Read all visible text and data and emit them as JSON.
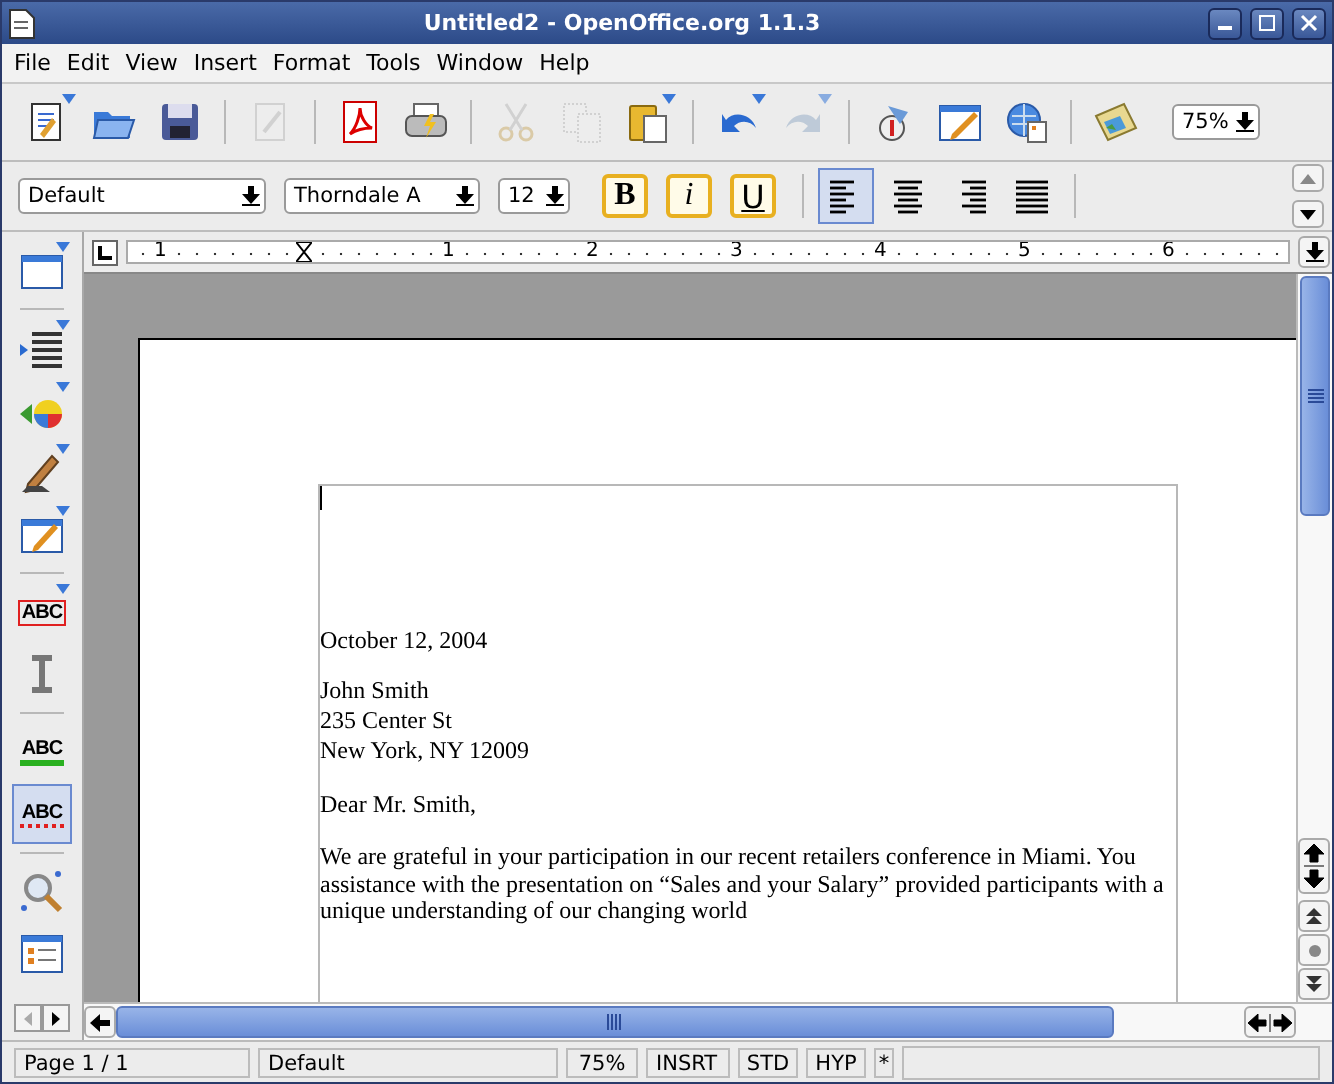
{
  "window": {
    "title": "Untitled2 - OpenOffice.org 1.1.3"
  },
  "menu": [
    {
      "label": "File"
    },
    {
      "label": "Edit"
    },
    {
      "label": "View"
    },
    {
      "label": "Insert"
    },
    {
      "label": "Format"
    },
    {
      "label": "Tools"
    },
    {
      "label": "Window"
    },
    {
      "label": "Help"
    }
  ],
  "function_bar": [
    {
      "kind": "new",
      "disabled": false,
      "menu": true
    },
    {
      "kind": "open",
      "disabled": false,
      "menu": false
    },
    {
      "kind": "save",
      "disabled": false,
      "menu": false
    },
    {
      "kind": "separator"
    },
    {
      "kind": "edit",
      "disabled": true,
      "menu": false
    },
    {
      "kind": "separator"
    },
    {
      "kind": "pdf",
      "disabled": false,
      "menu": false
    },
    {
      "kind": "print",
      "disabled": false,
      "menu": false
    },
    {
      "kind": "separator"
    },
    {
      "kind": "cut",
      "disabled": true,
      "menu": false
    },
    {
      "kind": "copy",
      "disabled": true,
      "menu": false
    },
    {
      "kind": "paste",
      "disabled": false,
      "menu": true
    },
    {
      "kind": "separator"
    },
    {
      "kind": "undo",
      "disabled": false,
      "menu": true
    },
    {
      "kind": "redo",
      "disabled": true,
      "menu": true
    },
    {
      "kind": "separator"
    },
    {
      "kind": "navigator",
      "disabled": false,
      "menu": false
    },
    {
      "kind": "draw",
      "disabled": false,
      "menu": false
    },
    {
      "kind": "web",
      "disabled": false,
      "menu": false
    },
    {
      "kind": "separator"
    },
    {
      "kind": "gallery",
      "disabled": false,
      "menu": false
    }
  ],
  "zoom": {
    "value": "75%"
  },
  "format_bar": {
    "style": "Default",
    "font": "Thorndale A",
    "size": "12",
    "buttons": [
      {
        "kind": "bold",
        "label": "B",
        "selected": false
      },
      {
        "kind": "italic",
        "label": "i",
        "selected": false
      },
      {
        "kind": "underline",
        "label": "U",
        "selected": false
      }
    ],
    "align": [
      {
        "kind": "left",
        "selected": true
      },
      {
        "kind": "center",
        "selected": false
      },
      {
        "kind": "right",
        "selected": false
      },
      {
        "kind": "justify",
        "selected": false
      }
    ]
  },
  "tool_bar": [
    {
      "kind": "insert",
      "selected": false,
      "menu": true
    },
    {
      "kind": "separator"
    },
    {
      "kind": "fields",
      "selected": false,
      "menu": true
    },
    {
      "kind": "objects",
      "selected": false,
      "menu": true
    },
    {
      "kind": "form",
      "selected": false,
      "menu": true
    },
    {
      "kind": "drawing",
      "selected": false,
      "menu": true
    },
    {
      "kind": "separator"
    },
    {
      "kind": "text",
      "label": "ABC",
      "selected": false,
      "menu": true
    },
    {
      "kind": "cursor",
      "selected": false,
      "menu": false
    },
    {
      "kind": "separator"
    },
    {
      "kind": "spell",
      "label": "ABC",
      "selected": false,
      "menu": false
    },
    {
      "kind": "autospell",
      "label": "ABC",
      "selected": true,
      "menu": false
    },
    {
      "kind": "separator"
    },
    {
      "kind": "find",
      "selected": false,
      "menu": false
    },
    {
      "kind": "datasource",
      "selected": false,
      "menu": false
    }
  ],
  "ruler": {
    "labels": [
      "1",
      "1",
      "2",
      "3",
      "4",
      "5",
      "6"
    ]
  },
  "document": {
    "date": "October 12, 2004",
    "address": [
      "John Smith",
      "235 Center St",
      "New York, NY 12009"
    ],
    "salutation": "Dear Mr. Smith,",
    "paragraph": "We are grateful in your participation in our recent retailers conference in Miami. You assistance with the presentation on “Sales and your Salary” provided participants with a unique understanding of our changing world"
  },
  "status_bar": [
    "Page 1 / 1",
    "Default",
    "75%",
    "INSRT",
    "STD",
    "HYP",
    "*"
  ]
}
